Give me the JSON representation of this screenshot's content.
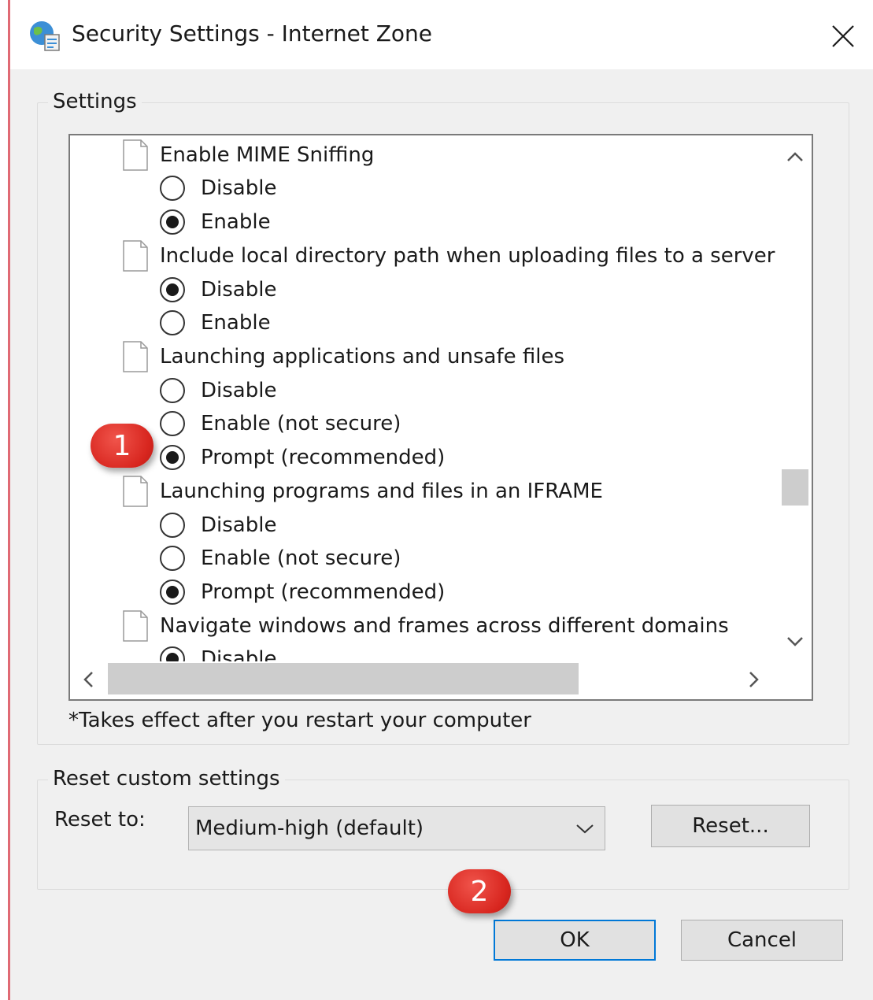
{
  "window": {
    "title": "Security Settings - Internet Zone",
    "title_icon": "globe-shield-icon",
    "close_icon": "close-icon"
  },
  "settings": {
    "group_label": "Settings",
    "footnote": "*Takes effect after you restart your computer",
    "items": [
      {
        "label": "Enable MIME Sniffing",
        "options": [
          {
            "label": "Disable",
            "selected": false
          },
          {
            "label": "Enable",
            "selected": true
          }
        ]
      },
      {
        "label": "Include local directory path when uploading files to a server",
        "options": [
          {
            "label": "Disable",
            "selected": true
          },
          {
            "label": "Enable",
            "selected": false
          }
        ]
      },
      {
        "label": "Launching applications and unsafe files",
        "options": [
          {
            "label": "Disable",
            "selected": false
          },
          {
            "label": "Enable (not secure)",
            "selected": false
          },
          {
            "label": "Prompt (recommended)",
            "selected": true
          }
        ]
      },
      {
        "label": "Launching programs and files in an IFRAME",
        "options": [
          {
            "label": "Disable",
            "selected": false
          },
          {
            "label": "Enable (not secure)",
            "selected": false
          },
          {
            "label": "Prompt (recommended)",
            "selected": true
          }
        ]
      },
      {
        "label": "Navigate windows and frames across different domains",
        "options": [
          {
            "label": "Disable",
            "selected": true
          }
        ]
      }
    ]
  },
  "reset": {
    "group_label": "Reset custom settings",
    "reset_to_label": "Reset to:",
    "selected_level": "Medium-high (default)",
    "reset_button": "Reset..."
  },
  "buttons": {
    "ok": "OK",
    "cancel": "Cancel"
  },
  "annotations": {
    "badge_1": "1",
    "badge_2": "2",
    "color": "#d8261f"
  },
  "colors": {
    "ok_focus_border": "#0078d7",
    "left_edge": "#e06a74"
  }
}
